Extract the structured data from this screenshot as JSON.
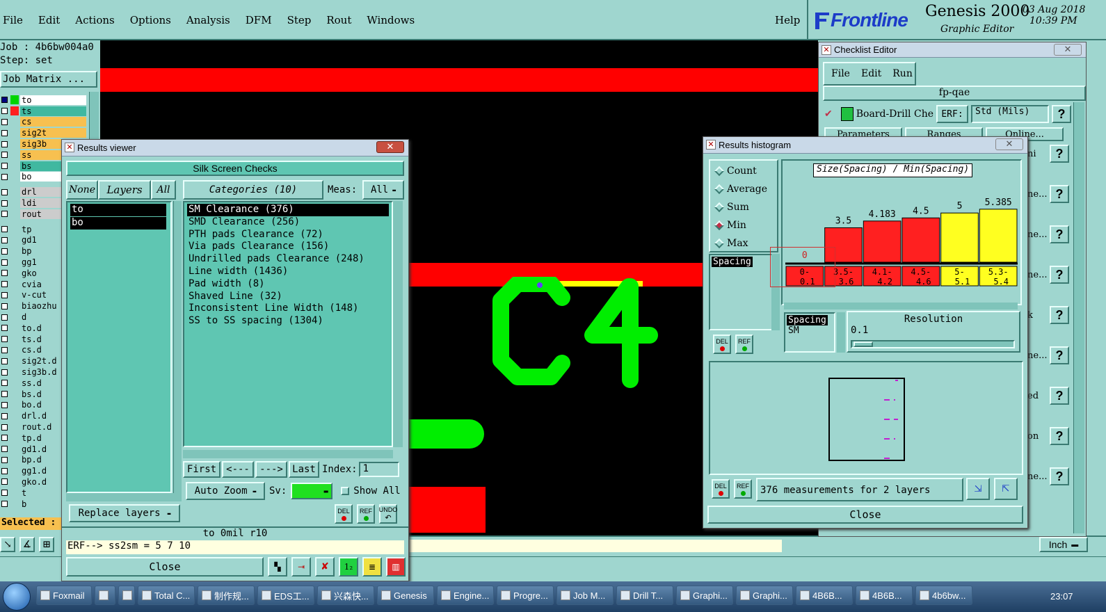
{
  "menubar": {
    "items": [
      "File",
      "Edit",
      "Actions",
      "Options",
      "Analysis",
      "DFM",
      "Step",
      "Rout",
      "Windows"
    ],
    "help": "Help"
  },
  "brand": {
    "logo": "Frontline",
    "product": "Genesis 2000",
    "subtitle": "Graphic Editor",
    "date": "03 Aug 2018",
    "time": "10:39 PM"
  },
  "job": {
    "job_line": "Job : 4b6bw004a0",
    "step_line": "Step: set",
    "matrix_button": "Job Matrix ...",
    "selected_label": "Selected : 0",
    "units_label": "Inch"
  },
  "layers": [
    {
      "name": "to",
      "color": "#ffffff",
      "swatch": "#00d400",
      "check": "#000080"
    },
    {
      "name": "ts",
      "color": "#40b8a0",
      "swatch": "#ff2020",
      "check": "#ffffff"
    },
    {
      "name": "cs",
      "color": "#f7c050",
      "swatch": "",
      "check": "#ffffff"
    },
    {
      "name": "sig2t",
      "color": "#f7c050",
      "swatch": "",
      "check": "#ffffff"
    },
    {
      "name": "sig3b",
      "color": "#f7c050",
      "swatch": "",
      "check": "#ffffff"
    },
    {
      "name": "ss",
      "color": "#f7c050",
      "swatch": "",
      "check": "#ffffff"
    },
    {
      "name": "bs",
      "color": "#40b8a0",
      "swatch": "",
      "check": "#ffffff"
    },
    {
      "name": "bo",
      "color": "#ffffff",
      "swatch": "",
      "check": "#ffffff"
    },
    {
      "name": "drl",
      "color": "#cccccc",
      "swatch": "",
      "check": "#ffffff"
    },
    {
      "name": "ldi",
      "color": "#cccccc",
      "swatch": "",
      "check": "#ffffff"
    },
    {
      "name": "rout",
      "color": "#cccccc",
      "swatch": "",
      "check": "#ffffff"
    },
    {
      "name": "tp",
      "color": "#9fd6cf",
      "swatch": "",
      "check": "#ffffff"
    },
    {
      "name": "gd1",
      "color": "#9fd6cf",
      "swatch": "",
      "check": "#ffffff"
    },
    {
      "name": "bp",
      "color": "#9fd6cf",
      "swatch": "",
      "check": "#ffffff"
    },
    {
      "name": "gg1",
      "color": "#9fd6cf",
      "swatch": "",
      "check": "#ffffff"
    },
    {
      "name": "gko",
      "color": "#9fd6cf",
      "swatch": "",
      "check": "#ffffff"
    },
    {
      "name": "cvia",
      "color": "#9fd6cf",
      "swatch": "",
      "check": "#ffffff"
    },
    {
      "name": "v-cut",
      "color": "#9fd6cf",
      "swatch": "",
      "check": "#ffffff"
    },
    {
      "name": "biaozhu",
      "color": "#9fd6cf",
      "swatch": "",
      "check": "#ffffff"
    },
    {
      "name": "d",
      "color": "#9fd6cf",
      "swatch": "",
      "check": "#ffffff"
    },
    {
      "name": "to.d",
      "color": "#9fd6cf",
      "swatch": "",
      "check": "#ffffff"
    },
    {
      "name": "ts.d",
      "color": "#9fd6cf",
      "swatch": "",
      "check": "#ffffff"
    },
    {
      "name": "cs.d",
      "color": "#9fd6cf",
      "swatch": "",
      "check": "#ffffff"
    },
    {
      "name": "sig2t.d",
      "color": "#9fd6cf",
      "swatch": "",
      "check": "#ffffff"
    },
    {
      "name": "sig3b.d",
      "color": "#9fd6cf",
      "swatch": "",
      "check": "#ffffff"
    },
    {
      "name": "ss.d",
      "color": "#9fd6cf",
      "swatch": "",
      "check": "#ffffff"
    },
    {
      "name": "bs.d",
      "color": "#9fd6cf",
      "swatch": "",
      "check": "#ffffff"
    },
    {
      "name": "bo.d",
      "color": "#9fd6cf",
      "swatch": "",
      "check": "#ffffff"
    },
    {
      "name": "drl.d",
      "color": "#9fd6cf",
      "swatch": "",
      "check": "#ffffff"
    },
    {
      "name": "rout.d",
      "color": "#9fd6cf",
      "swatch": "",
      "check": "#ffffff"
    },
    {
      "name": "tp.d",
      "color": "#9fd6cf",
      "swatch": "",
      "check": "#ffffff"
    },
    {
      "name": "gd1.d",
      "color": "#9fd6cf",
      "swatch": "",
      "check": "#ffffff"
    },
    {
      "name": "bp.d",
      "color": "#9fd6cf",
      "swatch": "",
      "check": "#ffffff"
    },
    {
      "name": "gg1.d",
      "color": "#9fd6cf",
      "swatch": "",
      "check": "#ffffff"
    },
    {
      "name": "gko.d",
      "color": "#9fd6cf",
      "swatch": "",
      "check": "#ffffff"
    },
    {
      "name": "t",
      "color": "#9fd6cf",
      "swatch": "",
      "check": "#ffffff"
    },
    {
      "name": "b",
      "color": "#9fd6cf",
      "swatch": "",
      "check": "#ffffff"
    }
  ],
  "canvas": {
    "label": "C4",
    "bg": "#000000",
    "pad_red": "#ff0000",
    "silk_green": "#00ee00"
  },
  "results_viewer": {
    "title": "Results viewer",
    "header": "Silk Screen Checks",
    "none_btn": "None",
    "layers_btn": "Layers",
    "all_btn": "All",
    "categories_label": "Categories (10)",
    "meas_label": "Meas:",
    "meas_value": "All",
    "layers": [
      "to",
      "bo"
    ],
    "categories": [
      "SM Clearance (376)",
      "SMD Clearance (256)",
      "PTH pads Clearance (72)",
      "Via pads Clearance (156)",
      "Undrilled pads Clearance (248)",
      "Line width (1436)",
      "Pad width (8)",
      "Shaved Line (32)",
      "Inconsistent Line Width (148)",
      "SS to SS spacing (1304)"
    ],
    "first_btn": "First",
    "prev_btn": "<---",
    "next_btn": "--->",
    "last_btn": "Last",
    "index_label": "Index:",
    "index_value": "1",
    "autozoom_btn": "Auto Zoom",
    "sv_label": "Sv:",
    "show_all_label": "Show All",
    "replace_btn": "Replace layers",
    "del": "DEL",
    "ref": "REF",
    "undo": "UNDO",
    "status1": "to 0mil  r10",
    "status2": "ERF--> ss2sm = 5 7 10",
    "close_btn": "Close"
  },
  "checklist": {
    "title": "Checklist Editor",
    "menu": [
      "File",
      "Edit",
      "Run"
    ],
    "name": "fp-qae",
    "row_label": "Board-Drill Che",
    "erf_label": "ERF:",
    "erf_value": "Std (Mils)",
    "params_btn": "Parameters",
    "ranges_btn": "Ranges",
    "online_btn": "Online...",
    "side_texts": [
      "ni",
      "ne...",
      "ne...",
      "ne...",
      "k",
      "ne...",
      "ed",
      "on",
      "ne..."
    ],
    "q": "?"
  },
  "histogram": {
    "title": "Results histogram",
    "modes": [
      "Count",
      "Average",
      "Sum",
      "Min",
      "Max"
    ],
    "selected_mode": "Min",
    "chart_title": "Size(Spacing) / Min(Spacing)",
    "left_list": [
      "Spacing"
    ],
    "sub_list": [
      "Spacing",
      "SM"
    ],
    "resolution_label": "Resolution",
    "resolution_value": "0.1",
    "summary": "376 measurements for 2 layers",
    "close_btn": "Close",
    "del": "DEL",
    "ref": "REF"
  },
  "chart_data": {
    "type": "bar",
    "title": "Size(Spacing) / Min(Spacing)",
    "categories": [
      "0-0.1",
      "3.5-3.6",
      "4.1-4.2",
      "4.5-4.6",
      "5-5.1",
      "5.3-5.4"
    ],
    "values": [
      0,
      3.5,
      4.183,
      4.5,
      5,
      5.385
    ],
    "value_labels": [
      "0",
      "3.5",
      "4.183",
      "4.5",
      "5",
      "5.385"
    ],
    "cat_top": [
      "0-",
      "3.5-",
      "4.1-",
      "4.5-",
      "5-",
      "5.3-"
    ],
    "cat_bottom": [
      "0.1",
      "3.6",
      "4.2",
      "4.6",
      "5.1",
      "5.4"
    ],
    "colors": [
      "#ff2020",
      "#ff2020",
      "#ff2020",
      "#ff2020",
      "#ffff20",
      "#ffff20"
    ],
    "ylim": [
      0,
      6.5
    ]
  },
  "taskbar": {
    "items": [
      "Foxmail",
      "",
      "",
      "Total C...",
      "制作规...",
      "EDS工...",
      "兴森快...",
      "Genesis",
      "Engine...",
      "Progre...",
      "Job M...",
      "Drill T...",
      "Graphi...",
      "Graphi...",
      "4B6B...",
      "4B6B...",
      "4b6bw..."
    ],
    "clock": "23:07"
  }
}
